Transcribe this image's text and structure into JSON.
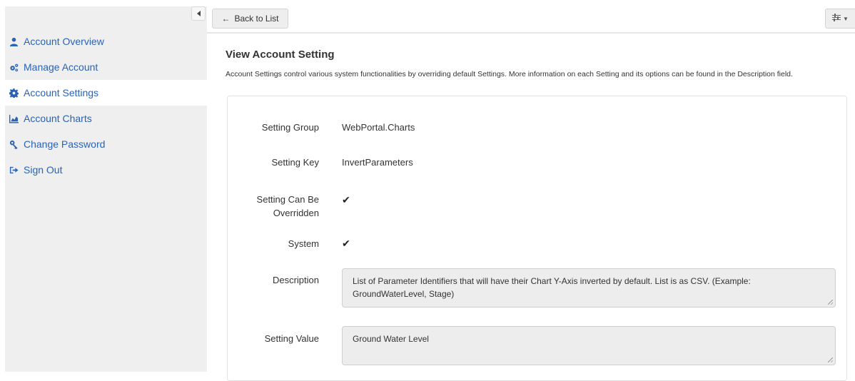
{
  "sidebar": {
    "items": [
      {
        "label": "Account Overview",
        "icon": "user-icon",
        "active": false
      },
      {
        "label": "Manage Account",
        "icon": "cogs-icon",
        "active": false
      },
      {
        "label": "Account Settings",
        "icon": "gear-icon",
        "active": true
      },
      {
        "label": "Account Charts",
        "icon": "area-chart-icon",
        "active": false
      },
      {
        "label": "Change Password",
        "icon": "key-icon",
        "active": false
      },
      {
        "label": "Sign Out",
        "icon": "sign-out-icon",
        "active": false
      }
    ]
  },
  "toolbar": {
    "back_label": "Back to List",
    "settings_icon": "sliders-icon"
  },
  "page": {
    "title": "View Account Setting",
    "description": "Account Settings control various system functionalities by overriding default Settings. More information on each Setting and its options can be found in the Description field."
  },
  "form": {
    "setting_group_label": "Setting Group",
    "setting_group_value": "WebPortal.Charts",
    "setting_key_label": "Setting Key",
    "setting_key_value": "InvertParameters",
    "can_be_overridden_label_1": "Setting Can Be",
    "can_be_overridden_label_2": "Overridden",
    "can_be_overridden_value": "✔",
    "system_label": "System",
    "system_value": "✔",
    "description_label": "Description",
    "description_value": "List of Parameter Identifiers that will have their Chart Y-Axis inverted by default. List is as CSV. (Example: GroundWaterLevel, Stage)",
    "setting_value_label": "Setting Value",
    "setting_value_value": "Ground Water Level"
  },
  "colors": {
    "link": "#2a63b5",
    "sidebar_bg": "#efefef",
    "field_bg": "#ededed"
  }
}
